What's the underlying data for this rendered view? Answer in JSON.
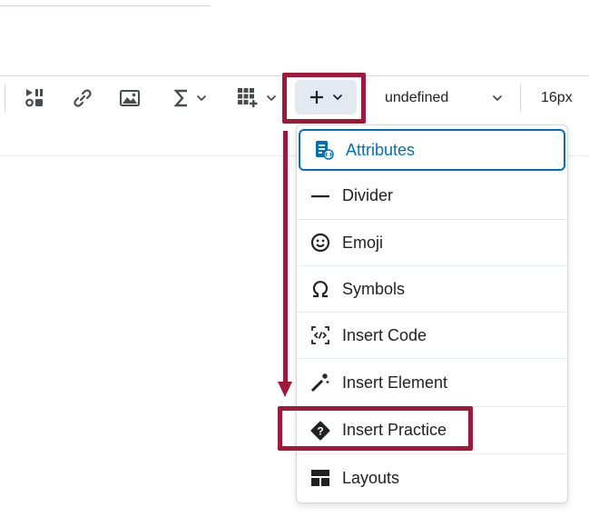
{
  "toolbar": {
    "font_family_value": "undefined",
    "font_size_value": "16px"
  },
  "insert_menu": {
    "items": [
      {
        "label": "Attributes",
        "icon": "attributes-icon"
      },
      {
        "label": "Divider",
        "icon": "divider-icon"
      },
      {
        "label": "Emoji",
        "icon": "emoji-icon"
      },
      {
        "label": "Symbols",
        "icon": "omega-icon"
      },
      {
        "label": "Insert Code",
        "icon": "code-icon"
      },
      {
        "label": "Insert Element",
        "icon": "magic-wand-icon"
      },
      {
        "label": "Insert Practice",
        "icon": "practice-icon"
      },
      {
        "label": "Layouts",
        "icon": "layout-icon"
      }
    ]
  },
  "colors": {
    "highlight": "#a2173a",
    "active_blue": "#006fbf",
    "icon_gray": "#494c4e"
  }
}
